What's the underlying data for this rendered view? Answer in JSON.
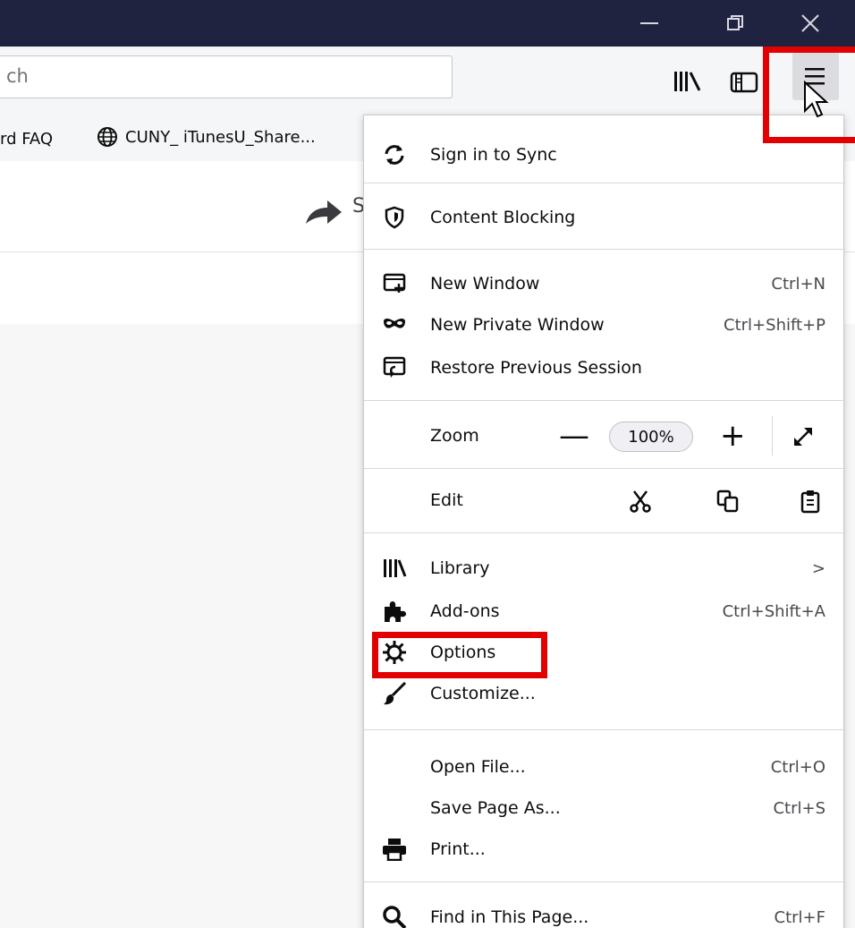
{
  "window": {
    "controls": [
      "minimize-icon",
      "restore-icon",
      "close-icon"
    ]
  },
  "navbar": {
    "url_fragment": "ch",
    "icons": [
      "library-icon",
      "sidebar-icon",
      "hamburger-menu-icon"
    ]
  },
  "bookmarks": {
    "items": [
      {
        "label": "rd FAQ"
      },
      {
        "label": "CUNY_ iTunesU_Share...",
        "icon": "globe-icon"
      }
    ]
  },
  "content": {
    "partial_text": "S"
  },
  "menu": {
    "sync": {
      "label": "Sign in to Sync",
      "icon": "sync-icon"
    },
    "content_blocking": {
      "label": "Content Blocking",
      "icon": "shield-icon"
    },
    "new_window": {
      "label": "New Window",
      "shortcut": "Ctrl+N",
      "icon": "new-window-icon"
    },
    "new_private_window": {
      "label": "New Private Window",
      "shortcut": "Ctrl+Shift+P",
      "icon": "mask-icon"
    },
    "restore_session": {
      "label": "Restore Previous Session",
      "icon": "restore-session-icon"
    },
    "zoom": {
      "label": "Zoom",
      "minus": "—",
      "level": "100%",
      "plus": "+",
      "icon": "fullscreen-icon"
    },
    "edit": {
      "label": "Edit",
      "icons": [
        "cut-icon",
        "copy-icon",
        "paste-icon"
      ]
    },
    "library": {
      "label": "Library",
      "arrow": ">",
      "icon": "library-icon"
    },
    "addons": {
      "label": "Add-ons",
      "shortcut": "Ctrl+Shift+A",
      "icon": "puzzle-icon"
    },
    "options": {
      "label": "Options",
      "icon": "gear-icon"
    },
    "customize": {
      "label": "Customize...",
      "icon": "paintbrush-icon"
    },
    "open_file": {
      "label": "Open File...",
      "shortcut": "Ctrl+O"
    },
    "save_page": {
      "label": "Save Page As...",
      "shortcut": "Ctrl+S"
    },
    "print": {
      "label": "Print...",
      "icon": "printer-icon"
    },
    "find": {
      "label": "Find in This Page...",
      "shortcut": "Ctrl+F",
      "icon": "search-icon"
    }
  },
  "colors": {
    "titlebar": "#202340",
    "highlight": "#e30000",
    "toolbar": "#f5f6f7"
  }
}
